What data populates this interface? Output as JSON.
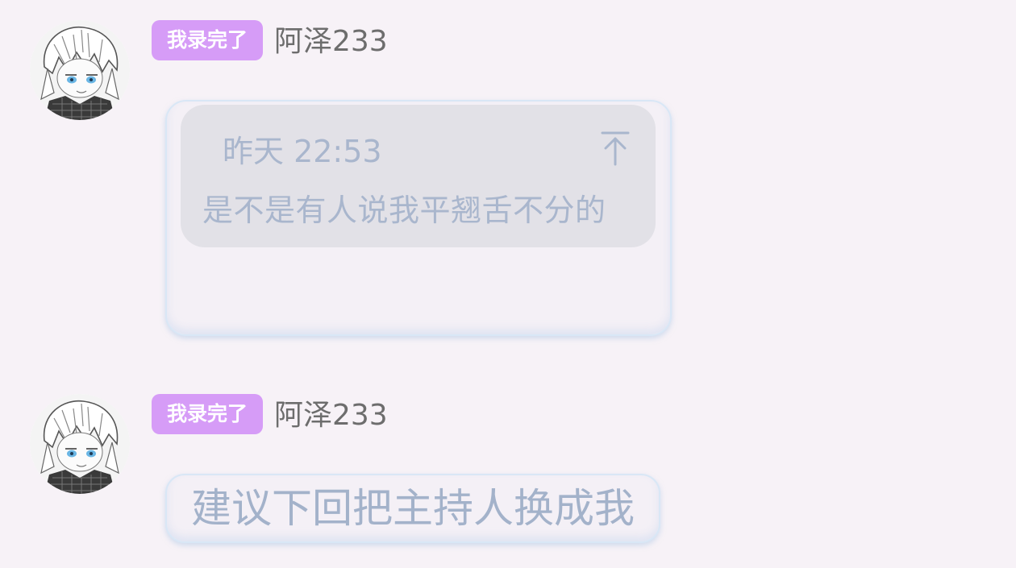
{
  "messages": [
    {
      "badge": "我录完了",
      "username": "阿泽233",
      "reply": {
        "time": "昨天 22:53",
        "text": "是不是有人说我平翘舌不分的",
        "jump_icon": "jump-to-message-icon"
      }
    },
    {
      "badge": "我录完了",
      "username": "阿泽233",
      "text": "建议下回把主持人换成我"
    }
  ],
  "colors": {
    "background": "#f7f2f7",
    "badge": "#d69cf7",
    "bubble_text": "#a3b2ca",
    "username": "#6d6d6d"
  }
}
